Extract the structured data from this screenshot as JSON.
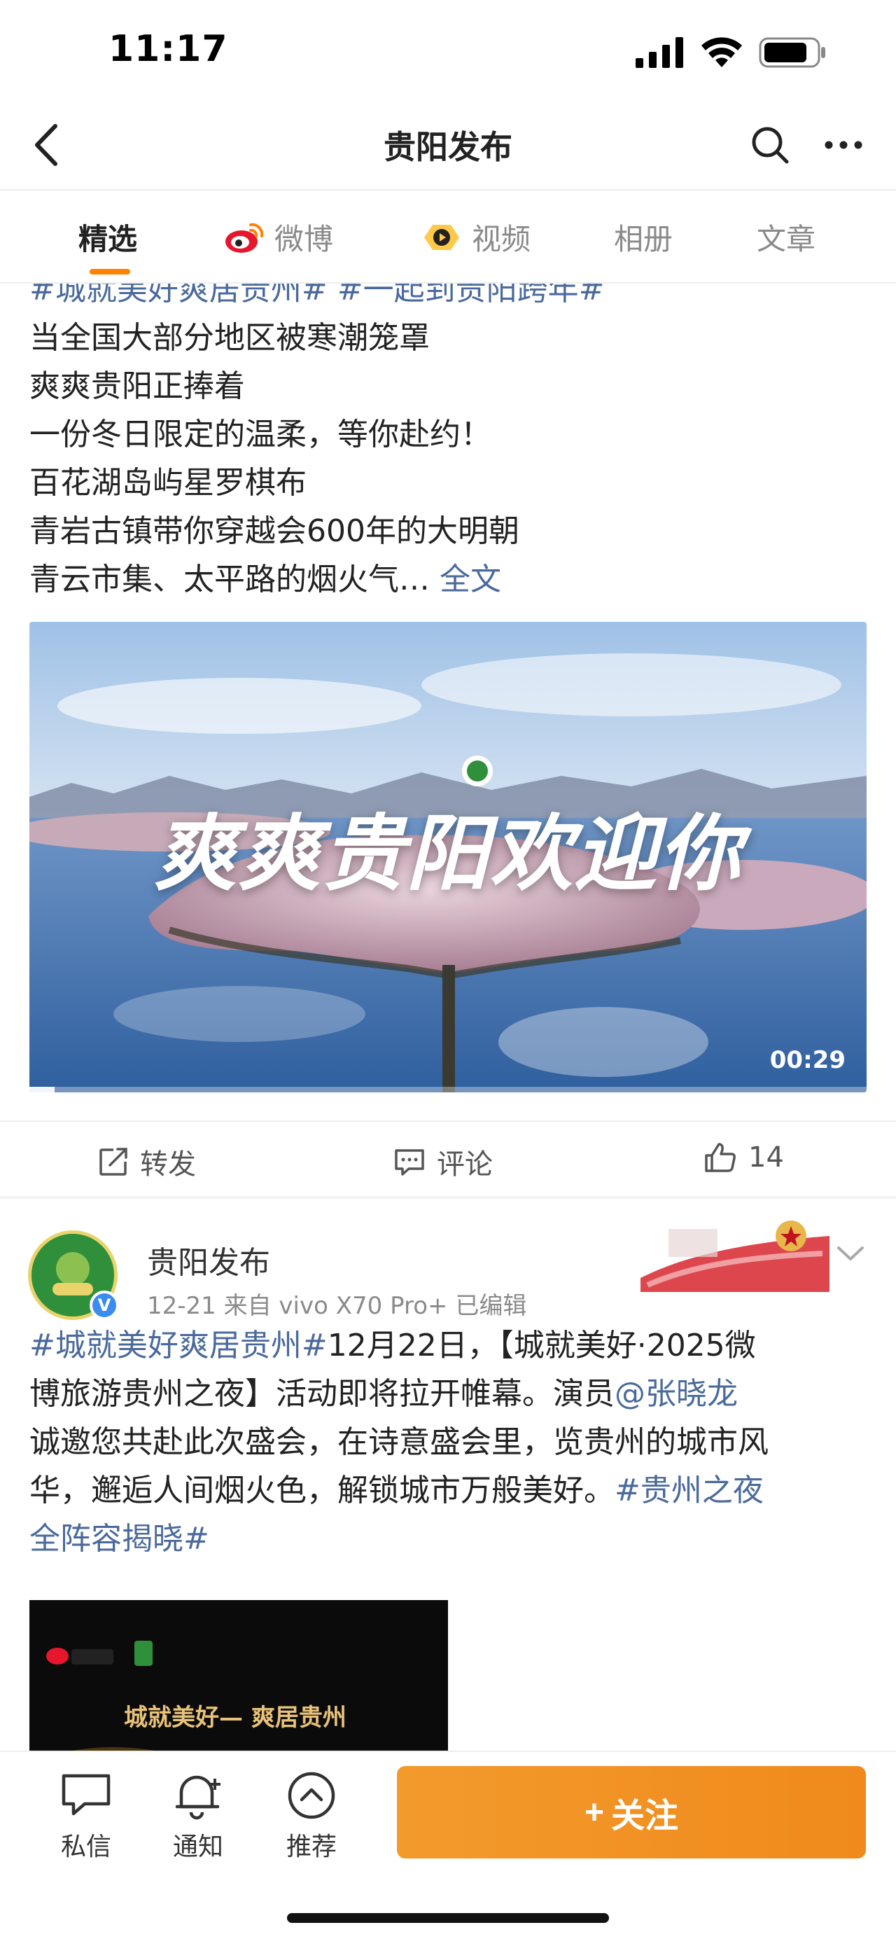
{
  "status_bar": {
    "time": "11:17"
  },
  "nav": {
    "title": "贵阳发布"
  },
  "tabs": [
    {
      "label": "精选",
      "active": true
    },
    {
      "label": "微博",
      "icon": "weibo-icon"
    },
    {
      "label": "视频",
      "icon": "video-badge-icon"
    },
    {
      "label": "相册"
    },
    {
      "label": "文章"
    }
  ],
  "post1": {
    "hashtags_line": "#城就美好爽居贵州# #一起到贵阳跨年#",
    "lines": [
      "当全国大部分地区被寒潮笼罩",
      "爽爽贵阳正捧着",
      "一份冬日限定的温柔，等你赴约！",
      "百花湖岛屿星罗棋布",
      "青岩古镇带你穿越会600年的大明朝"
    ],
    "last_line": "青云市集、太平路的烟火气…",
    "more_link": "全文",
    "video": {
      "overlay_text": "爽爽贵阳欢迎你",
      "duration": "00:29",
      "progress": 0.03
    },
    "actions": {
      "repost": "转发",
      "comment": "评论",
      "like_count": "14"
    }
  },
  "post2": {
    "author": "贵阳发布",
    "date": "12-21",
    "source": "来自 vivo X70 Pro+",
    "edited": "已编辑",
    "verified_badge": "V",
    "text": {
      "hashtag1": "#城就美好爽居贵州#",
      "part1": "12月22日，【城就美好·2025微",
      "line2a": "博旅游贵州之夜】活动即将拉开帷幕。演员",
      "mention": "@张晓龙",
      "line3": "诚邀您共赴此次盛会，在诗意盛会里，览贵州的城市风",
      "line4a": "华，邂逅人间烟火色，解锁城市万般美好。",
      "hashtag2a": "#贵州之夜",
      "hashtag2b": "全阵容揭晓#"
    },
    "image_texts": {
      "slogan": "城就美好— 爽居贵州"
    }
  },
  "bottom_bar": {
    "message": "私信",
    "notify": "通知",
    "recommend": "推荐",
    "follow": "关注",
    "follow_plus": "+"
  },
  "colors": {
    "accent": "#ff8200",
    "link": "#4a6a9c",
    "follow_button": "#f39a2c"
  }
}
